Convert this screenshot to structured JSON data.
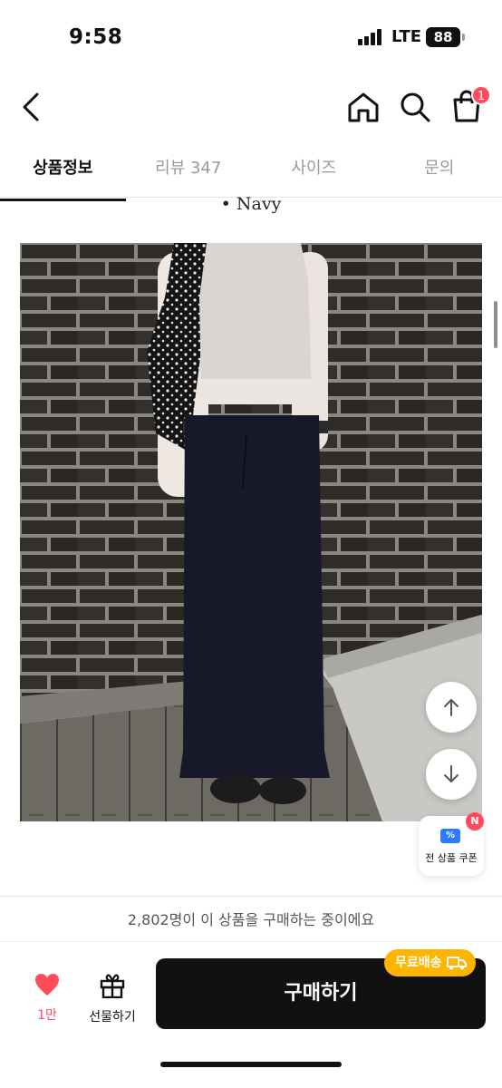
{
  "status_bar": {
    "time": "9:58",
    "network": "LTE",
    "battery": "88"
  },
  "nav": {
    "cart_count": "1"
  },
  "tabs": [
    {
      "label": "상품정보"
    },
    {
      "label": "리뷰 347"
    },
    {
      "label": "사이즈"
    },
    {
      "label": "문의"
    }
  ],
  "content": {
    "variant_label": "• Navy"
  },
  "coupon": {
    "label": "전 상품 쿠폰",
    "badge": "N"
  },
  "bottom": {
    "buying_notice": "2,802명이 이 상품을 구매하는 중이에요",
    "like_count": "1만",
    "gift_label": "선물하기",
    "buy_label": "구매하기",
    "shipping_badge": "무료배송"
  },
  "colors": {
    "accent_red": "#ff4b5c",
    "shipping_yellow": "#ffb400",
    "coupon_blue": "#2b7cff",
    "buy_button": "#111111"
  }
}
